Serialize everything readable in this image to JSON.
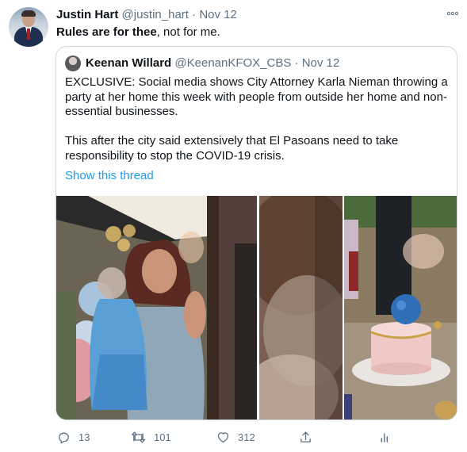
{
  "tweet": {
    "author_name": "Justin Hart",
    "author_handle": "@justin_hart",
    "separator": "·",
    "date": "Nov 12",
    "text_bold": "Rules are for thee",
    "text_rest": ", not for me."
  },
  "quoted": {
    "author_name": "Keenan Willard",
    "author_handle": "@KeenanKFOX_CBS",
    "separator": "·",
    "date": "Nov 12",
    "paragraph1": "EXCLUSIVE: Social media shows City Attorney Karla Nieman throwing a party at her home this week with people from outside her home and non-essential businesses.",
    "paragraph2": "This after the city said extensively that El Pasoans need to take responsibility to stop the COVID-19 crisis.",
    "show_thread": "Show this thread"
  },
  "actions": {
    "replies": "13",
    "retweets": "101",
    "likes": "312"
  },
  "colors": {
    "link": "#1d9bf0",
    "muted": "#5b7083",
    "border": "#cfd9de"
  },
  "icons": [
    "more-icon",
    "reply-icon",
    "retweet-icon",
    "like-icon",
    "share-icon",
    "analytics-icon"
  ]
}
